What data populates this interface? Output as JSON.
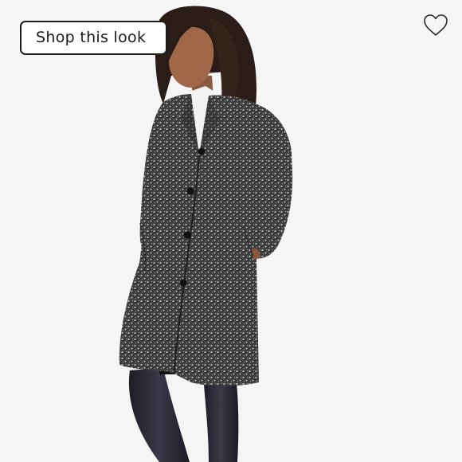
{
  "shop_button": {
    "label": "Shop this look"
  },
  "favorite": {
    "icon": "heart-outline-icon",
    "color": "#2a2a2a"
  },
  "photo": {
    "icon": "product-photo",
    "background_color": "#f5f5f5",
    "coat_color": "#3c3c3c"
  }
}
